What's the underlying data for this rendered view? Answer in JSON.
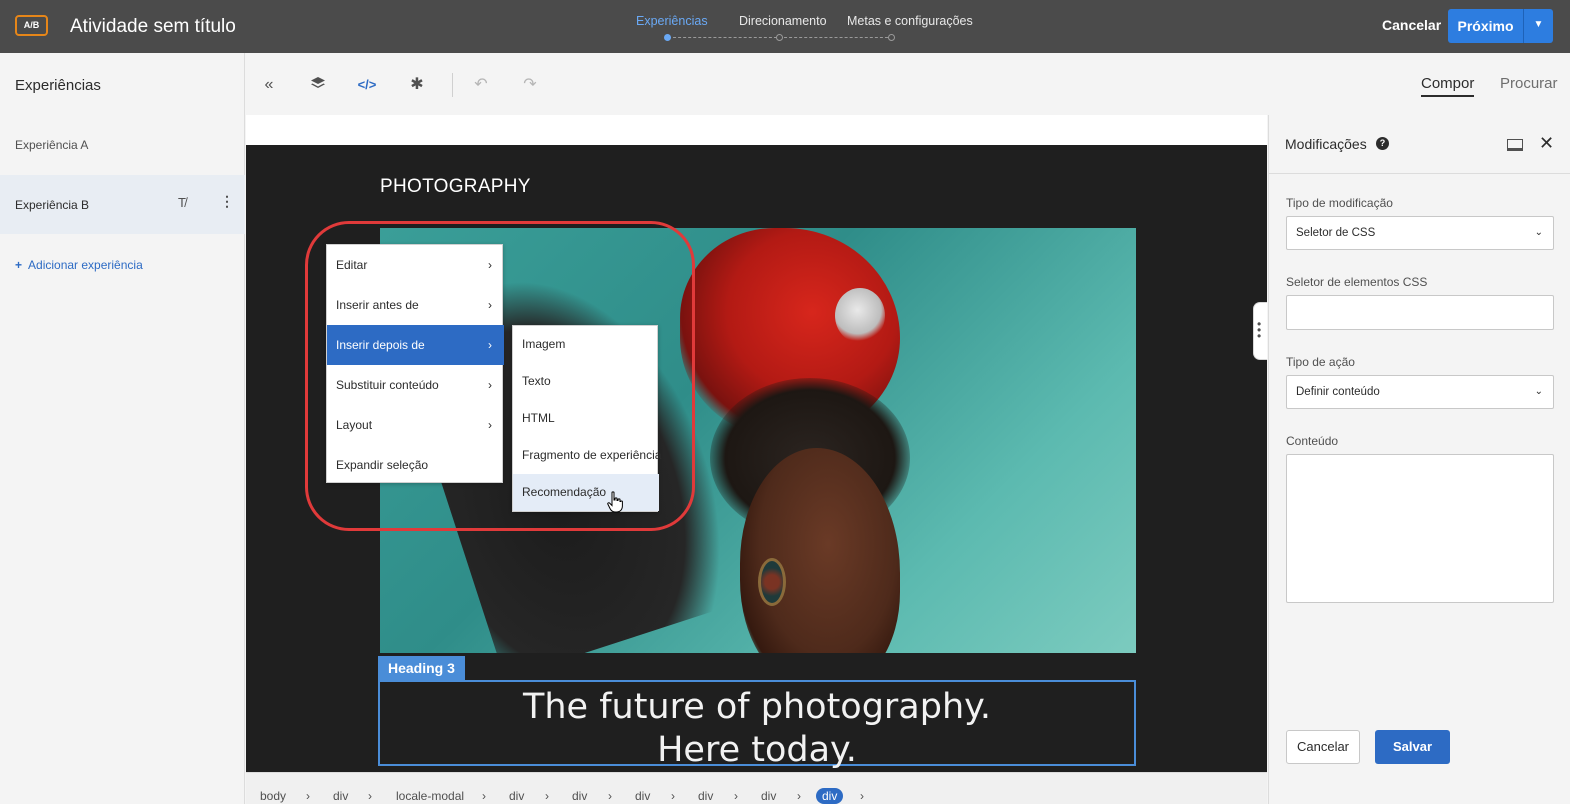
{
  "header": {
    "badge": "A/B",
    "title": "Atividade sem título",
    "steps": [
      {
        "label": "Experiências",
        "active": true
      },
      {
        "label": "Direcionamento",
        "active": false
      },
      {
        "label": "Metas e configurações",
        "active": false
      }
    ],
    "cancel_label": "Cancelar",
    "next_label": "Próximo",
    "accent_color": "#2d7de0"
  },
  "sidebar": {
    "title": "Experiências",
    "experiences": [
      {
        "label": "Experiência A",
        "selected": false
      },
      {
        "label": "Experiência B",
        "selected": true
      }
    ],
    "add_label": "Adicionar experiência"
  },
  "toolbar": {
    "icons": [
      "collapse-icon",
      "layers-icon",
      "code-icon",
      "settings-icon",
      "undo-icon",
      "redo-icon"
    ],
    "tabs": [
      {
        "label": "Compor",
        "active": true
      },
      {
        "label": "Procurar",
        "active": false
      }
    ]
  },
  "canvas": {
    "section_label": "PHOTOGRAPHY",
    "heading_tag": "Heading 3",
    "heading_line1": "The future of photography.",
    "heading_line2": "Here today."
  },
  "context_menu": {
    "items": [
      {
        "label": "Editar",
        "has_submenu": true,
        "active": false
      },
      {
        "label": "Inserir antes de",
        "has_submenu": true,
        "active": false
      },
      {
        "label": "Inserir depois de",
        "has_submenu": true,
        "active": true
      },
      {
        "label": "Substituir conteúdo",
        "has_submenu": true,
        "active": false
      },
      {
        "label": "Layout",
        "has_submenu": true,
        "active": false
      },
      {
        "label": "Expandir seleção",
        "has_submenu": false,
        "active": false
      }
    ],
    "submenu": [
      {
        "label": "Imagem",
        "hover": false
      },
      {
        "label": "Texto",
        "hover": false
      },
      {
        "label": "HTML",
        "hover": false
      },
      {
        "label": "Fragmento de experiência",
        "hover": false
      },
      {
        "label": "Recomendação",
        "hover": true
      }
    ],
    "highlight_color": "#e03a3a"
  },
  "breadcrumb": [
    "body",
    "div",
    "locale-modal",
    "div",
    "div",
    "div",
    "div",
    "div",
    "div"
  ],
  "panel": {
    "title": "Modificações",
    "modification_type_label": "Tipo de modificação",
    "modification_type_value": "Seletor de CSS",
    "css_selector_label": "Seletor de elementos CSS",
    "css_selector_value": "",
    "action_type_label": "Tipo de ação",
    "action_type_value": "Definir conteúdo",
    "content_label": "Conteúdo",
    "content_value": "",
    "cancel_label": "Cancelar",
    "save_label": "Salvar"
  }
}
